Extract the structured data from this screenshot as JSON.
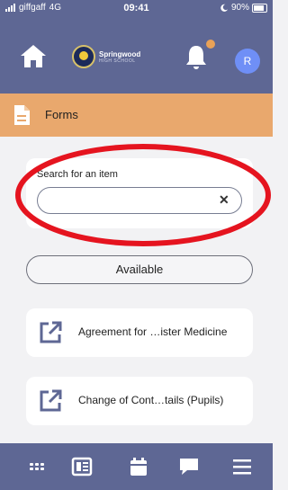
{
  "status_bar": {
    "carrier": "giffgaff",
    "network": "4G",
    "time": "09:41",
    "battery": "90%"
  },
  "header": {
    "logo_title": "Springwood",
    "logo_subtitle": "HIGH SCHOOL",
    "avatar_initial": "R",
    "notification_dot_color": "#e9a257"
  },
  "section": {
    "title": "Forms",
    "icon": "document-icon"
  },
  "search": {
    "label": "Search for an item",
    "value": "",
    "clear_icon": "close-icon"
  },
  "filter": {
    "label": "Available"
  },
  "items": [
    {
      "label": "Agreement for …ister Medicine",
      "icon": "external-link-icon"
    },
    {
      "label": "Change of Cont…tails (Pupils)",
      "icon": "external-link-icon"
    }
  ],
  "bottom_nav": [
    {
      "name": "apps-grid-icon"
    },
    {
      "name": "news-icon"
    },
    {
      "name": "calendar-icon"
    },
    {
      "name": "chat-icon"
    },
    {
      "name": "menu-icon"
    }
  ],
  "colors": {
    "primary": "#5e6794",
    "section": "#e9a86d",
    "annotation": "#e5141f"
  }
}
